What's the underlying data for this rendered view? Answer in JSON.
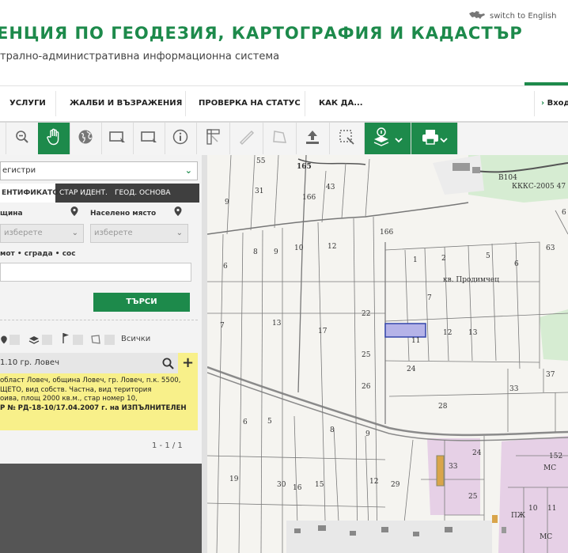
{
  "header": {
    "agency_title": "ЕНЦИЯ ПО ГЕОДЕЗИЯ, КАРТОГРАФИЯ И КАДАСТЪР",
    "subtitle": "трално-административна информационна система",
    "lang_switch": "switch to English"
  },
  "nav": {
    "items": [
      "УСЛУГИ",
      "ЖАЛБИ И ВЪЗРАЖЕНИЯ",
      "ПРОВЕРКА НА СТАТУС",
      "КАК ДА..."
    ],
    "login": "Вход"
  },
  "toolbar": {
    "icons": [
      "zoom-in-icon",
      "zoom-out-icon",
      "pan-hand-icon",
      "globe-icon",
      "select-rect-icon",
      "select-rect-alt-icon",
      "info-icon",
      "measure-ruler-icon",
      "ruler-icon",
      "area-icon",
      "upload-icon",
      "select-area-icon",
      "layers-icon",
      "print-icon"
    ]
  },
  "panel": {
    "register_select": "егистри",
    "tabs": [
      "ЕНТИФИКАТОР",
      "СТАР ИДЕНТ.",
      "ГЕОД. ОСНОВА"
    ],
    "municipality_label": "щина",
    "settlement_label": "Населено място",
    "municipality_placeholder": "изберете",
    "settlement_placeholder": "изберете",
    "object_label": "мот • сграда • сос",
    "search_button": "ТЪРСИ",
    "filter_all": "Всички",
    "result_title": "1.10 гр. Ловеч",
    "result_lines": [
      "област Ловеч, община Ловеч, гр. Ловеч, п.к. 5500,",
      "ЩЕТО, вид собств. Частна, вид територия",
      "оива, площ 2000 кв.м., стар номер 10,",
      "Р № РД-18-10/17.04.2007 г. на ИЗПЪЛНИТЕЛЕН"
    ],
    "pager": "1 - 1 / 1"
  },
  "map": {
    "labels": [
      "55",
      "165",
      "43",
      "31",
      "166",
      "166",
      "B104",
      "КККС-2005 47",
      "6",
      "9",
      "12",
      "8",
      "10",
      "6",
      "63",
      "1",
      "2",
      "5",
      "6",
      "кв. Продимчец",
      "7",
      "13",
      "17",
      "22",
      "11",
      "12",
      "13",
      "7",
      "25",
      "24",
      "37",
      "26",
      "33",
      "28",
      "8",
      "6",
      "5",
      "9",
      "19",
      "30",
      "16",
      "15",
      "12",
      "29",
      "33",
      "24",
      "152",
      "МС",
      "25",
      "10",
      "11",
      "ПЖ",
      "МС"
    ]
  },
  "colors": {
    "brand_green": "#1d8a4b",
    "result_yellow": "#f8f08a",
    "highlight_parcel": "#b5b3e8",
    "forest_green": "#d6ecd2",
    "pink_zone": "#e6d0e6"
  }
}
